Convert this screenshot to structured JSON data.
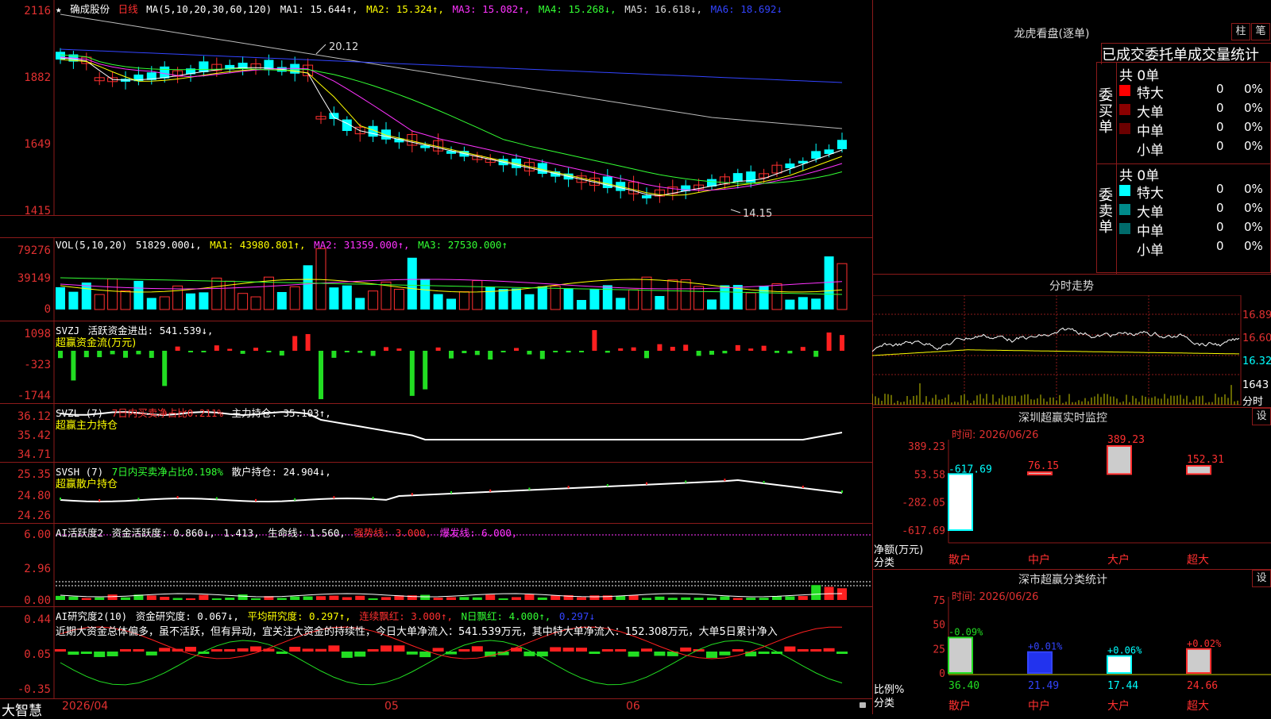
{
  "stock": {
    "name": "确成股份",
    "period": "日线"
  },
  "main": {
    "ma_label": "MA(5,10,20,30,60,120)",
    "ma1": "MA1: 15.644↑,",
    "ma2": "MA2: 15.324↑,",
    "ma3": "MA3: 15.082↑,",
    "ma4": "MA4: 15.268↓,",
    "ma5": "MA5: 16.618↓,",
    "ma6": "MA6: 18.692↓",
    "yticks": [
      "2116",
      "1882",
      "1649",
      "1415"
    ],
    "high_label": "20.12",
    "low_label": "14.15"
  },
  "vol": {
    "label": "VOL(5,10,20)",
    "value": "51829.000↓,",
    "ma1": "MA1: 43980.801↑,",
    "ma2": "MA2: 31359.000↑,",
    "ma3": "MA3: 27530.000↑",
    "yticks": [
      "79276",
      "39149",
      "0"
    ]
  },
  "svzj": {
    "label": "SVZJ",
    "text": "活跃资金进出: 541.539↓,",
    "sub": "超赢资金流(万元)",
    "yticks": [
      "1098",
      "-323",
      "-1744"
    ]
  },
  "svzl": {
    "label": "SVZL (7)",
    "ratio": "7日内买卖净占比0.211%",
    "hold": "主力持仓: 35.103↑,",
    "sub": "超赢主力持仓",
    "yticks": [
      "36.12",
      "35.42",
      "34.71"
    ]
  },
  "svsh": {
    "label": "SVSH (7)",
    "ratio": "7日内买卖净占比0.198%",
    "hold": "散户持仓: 24.904↓,",
    "sub": "超赢散户持仓",
    "yticks": [
      "25.35",
      "24.80",
      "24.26"
    ]
  },
  "ai1": {
    "label": "AI活跃度2",
    "t1": "资金活跃度: 0.860↓,",
    "t2": "1.413,",
    "t3": "生命线: 1.560,",
    "t4": "强势线: 3.000,",
    "t5": "爆发线: 6.000,",
    "yticks": [
      "6.00",
      "2.96",
      "0.00"
    ]
  },
  "ai2": {
    "label": "AI研究度2(10)",
    "t1": "资金研究度: 0.067↓,",
    "t2": "平均研究度: 0.297↑,",
    "t3": "连续飘红: 3.000↑,",
    "t4": "N日飘红: 4.000↑,",
    "t5": "0.297↓",
    "comment": "近期大资金总体偏多，虽不活跃，但有异动，宜关注大资金的持续性，今日大单净流入：541.539万元，其中特大单净流入：152.308万元，大单5日累计净入",
    "yticks": [
      "0.44",
      "0.05",
      "-0.35"
    ]
  },
  "footer": {
    "brand": "大智慧",
    "dates": [
      "2026/04",
      "05",
      "06"
    ]
  },
  "lhb": {
    "title": "龙虎看盘(逐单)",
    "btn_zhu": "柱",
    "btn_bi": "笔",
    "tabs": "已成交委托单成交量统计",
    "buy_side": "委买单",
    "sell_side": "委卖单",
    "buy_total": "共 0单",
    "sell_total": "共 0单",
    "buy_rows": [
      {
        "label": "特大",
        "count": "0",
        "pct": "0%"
      },
      {
        "label": "大单",
        "count": "0",
        "pct": "0%"
      },
      {
        "label": "中单",
        "count": "0",
        "pct": "0%"
      },
      {
        "label": "小单",
        "count": "0",
        "pct": "0%"
      }
    ],
    "sell_rows": [
      {
        "label": "特大",
        "count": "0",
        "pct": "0%"
      },
      {
        "label": "大单",
        "count": "0",
        "pct": "0%"
      },
      {
        "label": "中单",
        "count": "0",
        "pct": "0%"
      },
      {
        "label": "小单",
        "count": "0",
        "pct": "0%"
      }
    ],
    "colors": {
      "buy": [
        "#ff0000",
        "#8b0000",
        "#6b0000",
        "#000000"
      ],
      "sell": [
        "#00ffff",
        "#008b8b",
        "#006b6b",
        "#000000"
      ]
    }
  },
  "intraday": {
    "title": "分时走势",
    "yticks": [
      "16.89",
      "16.60",
      "16.32"
    ],
    "vol_label": "1643",
    "vol_sub": "分时"
  },
  "monitor": {
    "title": "深圳超赢实时监控",
    "btn": "设",
    "time": "时间: 2026/06/26",
    "yticks": [
      "389.23",
      "53.58",
      "-282.05",
      "-617.69"
    ],
    "ylabel1": "净额(万元)",
    "ylabel2": "分类",
    "categories": [
      "散户",
      "中户",
      "大户",
      "超大"
    ],
    "values": [
      -617.69,
      76.15,
      389.23,
      152.31
    ],
    "value_labels": [
      "-617.69",
      "76.15",
      "389.23",
      "152.31"
    ]
  },
  "classify": {
    "title": "深市超赢分类统计",
    "btn": "设",
    "time": "时间: 2026/06/26",
    "yticks": [
      "75",
      "50",
      "25",
      "0"
    ],
    "ylabel1": "比例%",
    "ylabel2": "分类",
    "categories": [
      "散户",
      "中户",
      "大户",
      "超大"
    ],
    "values": [
      36.4,
      21.49,
      17.44,
      24.66
    ],
    "delta_labels": [
      "-0.09%",
      "+0.01%",
      "+0.06%",
      "+0.02%"
    ],
    "value_labels": [
      "36.40",
      "21.49",
      "17.44",
      "24.66"
    ]
  }
}
